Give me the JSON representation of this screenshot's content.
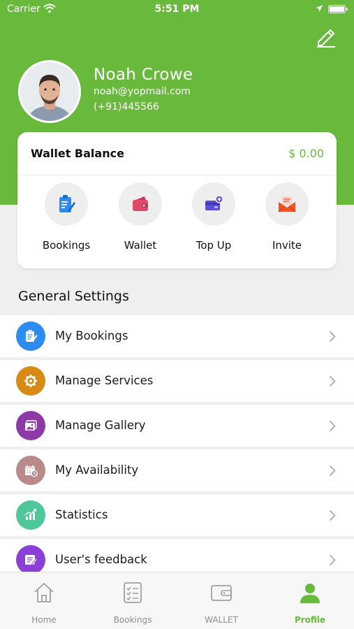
{
  "status_bar": {
    "carrier": "Carrier",
    "time": "5:51 PM"
  },
  "profile": {
    "name": "Noah Crowe",
    "email": "noah@yopmail.com",
    "phone": "(+91)445566"
  },
  "wallet": {
    "title": "Wallet Balance",
    "amount": "$ 0.00",
    "actions": [
      {
        "label": "Bookings",
        "icon": "clipboard-edit-icon",
        "color": "#2e8cf0"
      },
      {
        "label": "Wallet",
        "icon": "wallet-icon",
        "color": "#e0496a"
      },
      {
        "label": "Top Up",
        "icon": "top-up-card-icon",
        "color": "#5a4fd6"
      },
      {
        "label": "Invite",
        "icon": "envelope-icon",
        "color": "#f0532a"
      }
    ]
  },
  "general_settings": {
    "title": "General Settings",
    "items": [
      {
        "label": "My Bookings",
        "icon": "clipboard-icon",
        "color": "#2e8cf0"
      },
      {
        "label": "Manage Services",
        "icon": "gear-icon",
        "color": "#d98a14"
      },
      {
        "label": "Manage Gallery",
        "icon": "gallery-icon",
        "color": "#8e3aa6"
      },
      {
        "label": "My Availability",
        "icon": "calendar-clock-icon",
        "color": "#b88a8a"
      },
      {
        "label": "Statistics",
        "icon": "chart-icon",
        "color": "#4fc79a"
      },
      {
        "label": "User's feedback",
        "icon": "feedback-icon",
        "color": "#8a3fd6"
      }
    ]
  },
  "tab_bar": {
    "tabs": [
      {
        "label": "Home",
        "icon": "home-icon"
      },
      {
        "label": "Bookings",
        "icon": "checklist-icon"
      },
      {
        "label": "WALLET",
        "icon": "wallet-icon"
      },
      {
        "label": "Profile",
        "icon": "person-icon",
        "active": true
      }
    ]
  },
  "colors": {
    "brand_green": "#68b93c",
    "background": "#efefef"
  }
}
